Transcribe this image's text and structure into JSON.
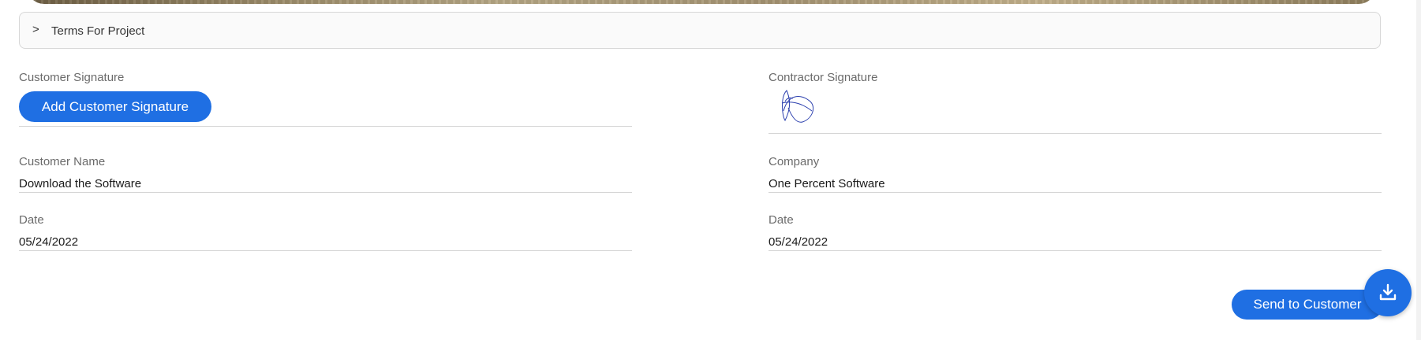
{
  "terms": {
    "chevron": ">",
    "label": "Terms For Project"
  },
  "customer": {
    "signature_label": "Customer Signature",
    "add_signature_button": "Add Customer Signature",
    "name_label": "Customer Name",
    "name_value": "Download the Software",
    "date_label": "Date",
    "date_value": "05/24/2022"
  },
  "contractor": {
    "signature_label": "Contractor Signature",
    "company_label": "Company",
    "company_value": "One Percent Software",
    "date_label": "Date",
    "date_value": "05/24/2022"
  },
  "actions": {
    "send_button": "Send to Customer",
    "download_icon": "download-icon"
  },
  "colors": {
    "primary": "#1f6fe3",
    "signature_ink": "#2b3fae"
  }
}
